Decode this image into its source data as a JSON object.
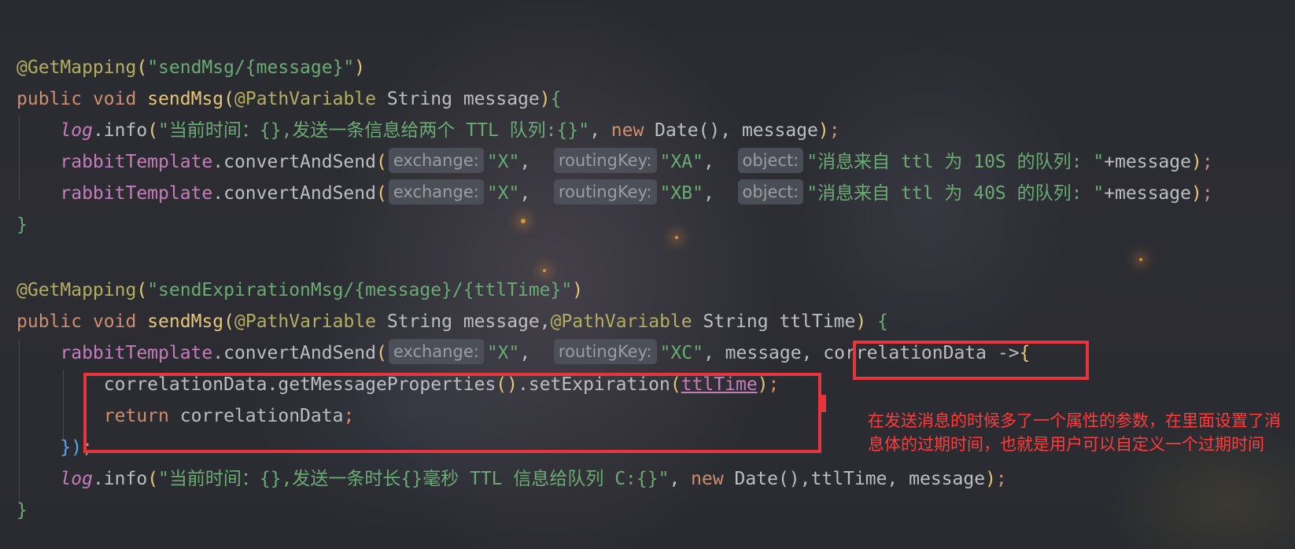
{
  "code": {
    "l1": {
      "anno": "@GetMapping",
      "p_open": "(",
      "path": "\"sendMsg/{message}\"",
      "p_close": ")"
    },
    "l2": {
      "kw_public": "public",
      "kw_void": "void",
      "method": "sendMsg",
      "p_open": "(",
      "anno": "@PathVariable",
      "type": "String",
      "param": "message",
      "p_close": ")",
      "brace": "{"
    },
    "l3": {
      "log": "log",
      "call": ".info",
      "p_open": "(",
      "str": "\"当前时间：{},发送一条信息给两个 TTL 队列:{}\"",
      "comma": ", ",
      "kw_new": "new",
      "date": " Date",
      "dp": "()",
      "rest": ", message",
      "p_close": ")",
      "semi": ";"
    },
    "l4": {
      "field": "rabbitTemplate",
      "call": ".convertAndSend",
      "p_open": "(",
      "hint1": "exchange:",
      "arg1": "\"X\"",
      "c1": ",  ",
      "hint2": "routingKey:",
      "arg2": "\"XA\"",
      "c2": ",  ",
      "hint3": "object:",
      "arg3": "\"消息来自 ttl 为 10S 的队列: \"",
      "plus": "+message",
      "p_close": ")",
      "semi": ";"
    },
    "l5": {
      "field": "rabbitTemplate",
      "call": ".convertAndSend",
      "p_open": "(",
      "hint1": "exchange:",
      "arg1": "\"X\"",
      "c1": ",  ",
      "hint2": "routingKey:",
      "arg2": "\"XB\"",
      "c2": ",  ",
      "hint3": "object:",
      "arg3": "\"消息来自 ttl 为 40S 的队列: \"",
      "plus": "+message",
      "p_close": ")",
      "semi": ";"
    },
    "l6": {
      "brace": "}"
    },
    "l7": {
      "anno": "@GetMapping",
      "p_open": "(",
      "path": "\"sendExpirationMsg/{message}/{ttlTime}\"",
      "p_close": ")"
    },
    "l8": {
      "kw_public": "public",
      "kw_void": "void",
      "method": "sendMsg",
      "p_open": "(",
      "anno1": "@PathVariable",
      "type1": "String",
      "param1": "message,",
      "anno2": "@PathVariable",
      "type2": "String",
      "param2": "ttlTime",
      "p_close": ")",
      "brace": "{"
    },
    "l9": {
      "field": "rabbitTemplate",
      "call": ".convertAndSend",
      "p_open": "(",
      "hint1": "exchange:",
      "arg1": "\"X\"",
      "c1": ",  ",
      "hint2": "routingKey:",
      "arg2": "\"XC\"",
      "rest": ", message, ",
      "lambda_param": "correlationData",
      "arrow": " ->",
      "brace": "{"
    },
    "l10": {
      "obj": "correlationData",
      "call1": ".getMessageProperties",
      "pp": "()",
      "call2": ".setExpiration",
      "p_open": "(",
      "arg": "ttlTime",
      "p_close": ")",
      "semi": ";"
    },
    "l11": {
      "kw_return": "return",
      "value": " correlationData",
      "semi": ";"
    },
    "l12": {
      "close": "})",
      "semi": ";"
    },
    "l13": {
      "log": "log",
      "call": ".info",
      "p_open": "(",
      "str": "\"当前时间：{},发送一条时长{}毫秒 TTL 信息给队列 C:{}\"",
      "comma": ", ",
      "kw_new": "new",
      "date": " Date",
      "dp": "()",
      "rest": ",ttlTime, message",
      "p_close": ")",
      "semi": ";"
    },
    "l14": {
      "brace": "}"
    }
  },
  "annotation": {
    "note": "在发送消息的时候多了一个属性的参数，在里面设置了消息体的过期时间，也就是用户可以自定义一个过期时间",
    "color": "#e8353b"
  },
  "theme": {
    "keyword": "#cf8e6d",
    "method": "#e6c77a",
    "string": "#6aab73",
    "field": "#c77dbb",
    "annotation": "#b3ae60",
    "text": "#bcbec4"
  }
}
